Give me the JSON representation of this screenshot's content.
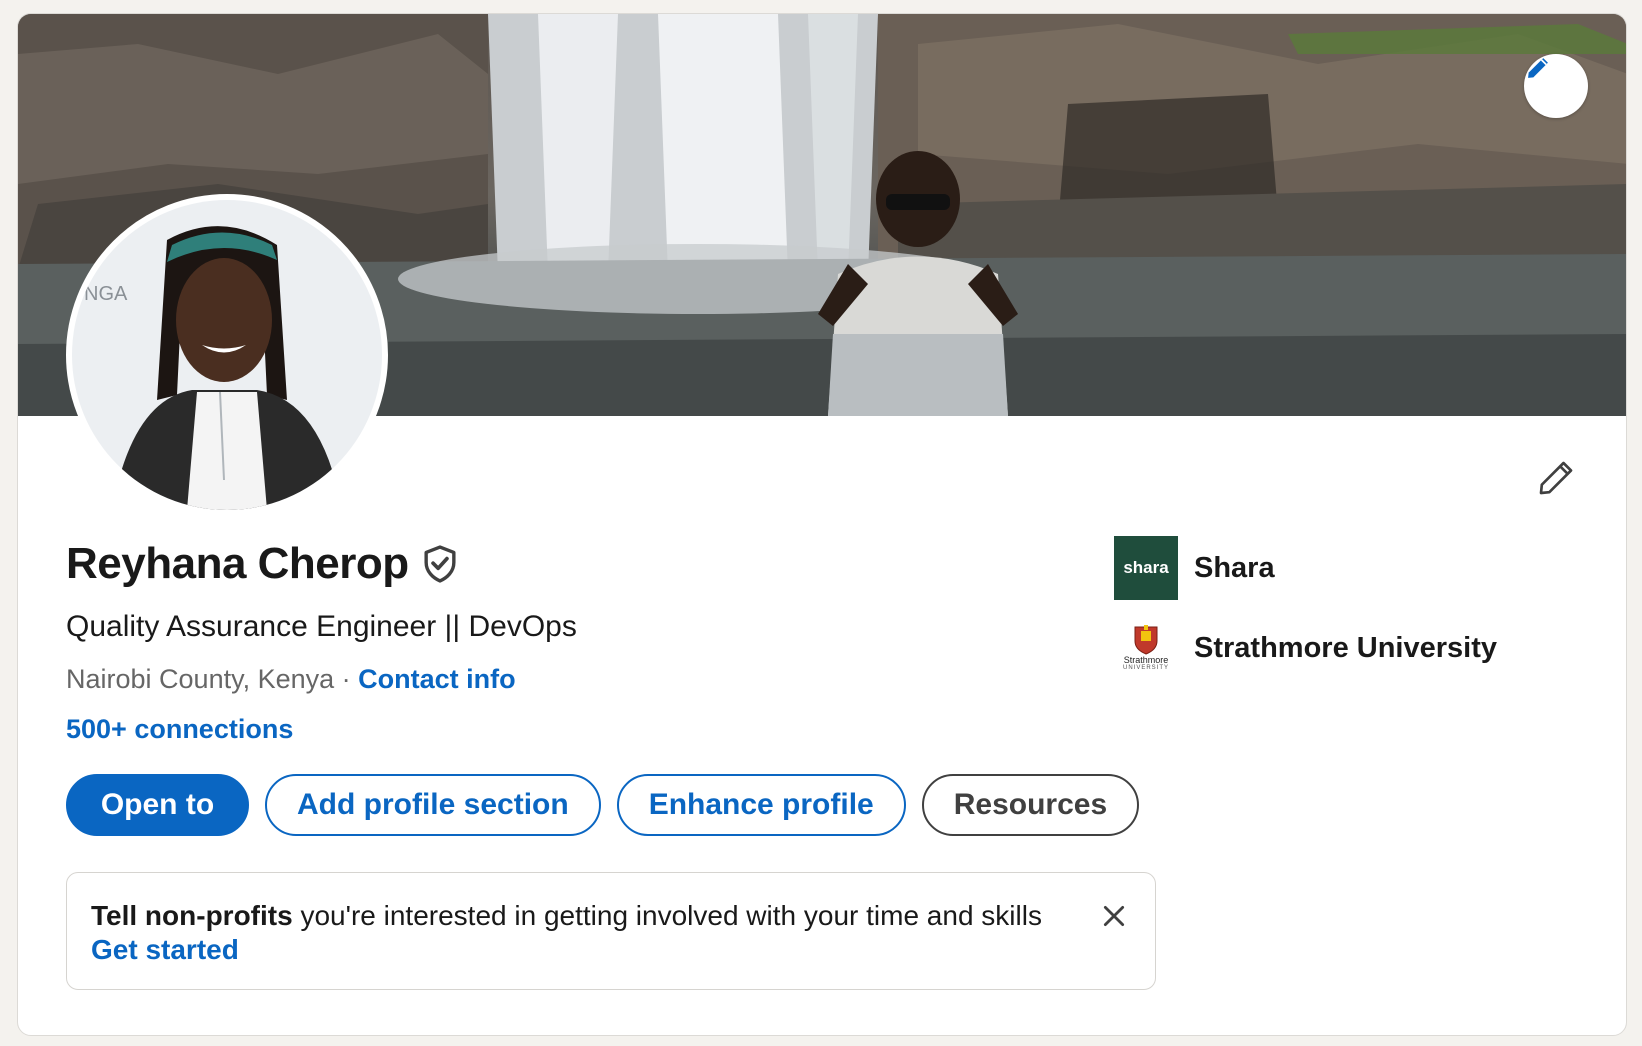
{
  "profile": {
    "name": "Reyhana Cherop",
    "headline": "Quality Assurance Engineer || DevOps",
    "location": "Nairobi County, Kenya",
    "separator": " · ",
    "contact_info": "Contact info",
    "connections": "500+ connections"
  },
  "actions": {
    "open_to": "Open to",
    "add_profile_section": "Add profile section",
    "enhance_profile": "Enhance profile",
    "resources": "Resources"
  },
  "organizations": [
    {
      "name": "Shara",
      "logo_text": "shara"
    },
    {
      "name": "Strathmore University",
      "logo_text": "Strathmore",
      "logo_subtext": "UNIVERSITY"
    }
  ],
  "notice": {
    "bold": "Tell non-profits",
    "text": " you're interested in getting involved with your time and skills",
    "cta": "Get started"
  },
  "colors": {
    "accent": "#0a66c2",
    "text": "#191919",
    "muted": "#666666",
    "shara_green": "#1f4d3c"
  },
  "icons": {
    "cover_edit": "pencil-icon",
    "intro_edit": "pencil-icon",
    "verified": "shield-check-icon",
    "close": "close-icon"
  }
}
